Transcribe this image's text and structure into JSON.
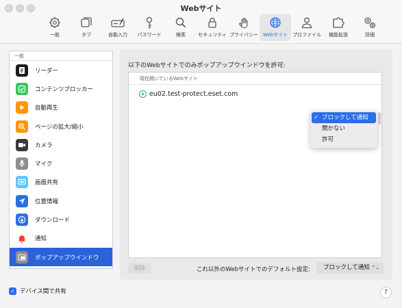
{
  "window": {
    "title": "Webサイト"
  },
  "toolbar": {
    "items": [
      {
        "label": "一般",
        "icon": "gear-icon"
      },
      {
        "label": "タブ",
        "icon": "tabs-icon"
      },
      {
        "label": "自動入力",
        "icon": "autofill-icon"
      },
      {
        "label": "パスワード",
        "icon": "key-icon"
      },
      {
        "label": "検索",
        "icon": "search-icon"
      },
      {
        "label": "セキュリティ",
        "icon": "lock-icon"
      },
      {
        "label": "プライバシー",
        "icon": "hand-icon"
      },
      {
        "label": "Webサイト",
        "icon": "globe-icon",
        "active": true
      },
      {
        "label": "プロファイル",
        "icon": "person-icon"
      },
      {
        "label": "機能拡張",
        "icon": "extension-icon"
      },
      {
        "label": "詳細",
        "icon": "gears-icon"
      }
    ]
  },
  "sidebar": {
    "section": "一般",
    "items": [
      {
        "label": "リーダー",
        "icon": "reader-icon",
        "color": "#1c1c1e"
      },
      {
        "label": "コンテンツブロッカー",
        "icon": "checkmark-icon",
        "color": "#34c759"
      },
      {
        "label": "自動再生",
        "icon": "play-icon",
        "color": "#ff9500"
      },
      {
        "label": "ページの拡大/縮小",
        "icon": "zoom-icon",
        "color": "#ff9500"
      },
      {
        "label": "カメラ",
        "icon": "camera-icon",
        "color": "#3a3a3c"
      },
      {
        "label": "マイク",
        "icon": "microphone-icon",
        "color": "#8e8e93"
      },
      {
        "label": "画面共有",
        "icon": "screen-share-icon",
        "color": "#5ac8fa"
      },
      {
        "label": "位置情報",
        "icon": "location-icon",
        "color": "#2a6ee8"
      },
      {
        "label": "ダウンロード",
        "icon": "download-icon",
        "color": "#2a6ee8"
      },
      {
        "label": "通知",
        "icon": "bell-icon",
        "color": "#ff3b30"
      },
      {
        "label": "ポップアップウインドウ",
        "icon": "popup-window-icon",
        "color": "#8e8e93",
        "selected": true
      }
    ]
  },
  "main": {
    "title": "以下のWebサイトでのみポップアップウインドウを許可:",
    "list_header": "現在開いているWebサイト",
    "site": "eu02.test-protect.eset.com",
    "popup_options": [
      "ブロックして通知",
      "開かない",
      "許可"
    ],
    "popup_selected": "ブロックして通知",
    "delete_label": "削除",
    "default_label": "これ以外のWebサイトでのデフォルト設定:",
    "default_value": "ブロックして通知"
  },
  "footer": {
    "share_label": "デバイス間で共有",
    "help": "?"
  },
  "colors": {
    "accent": "#2a6ee8",
    "selection": "#2962d9"
  }
}
